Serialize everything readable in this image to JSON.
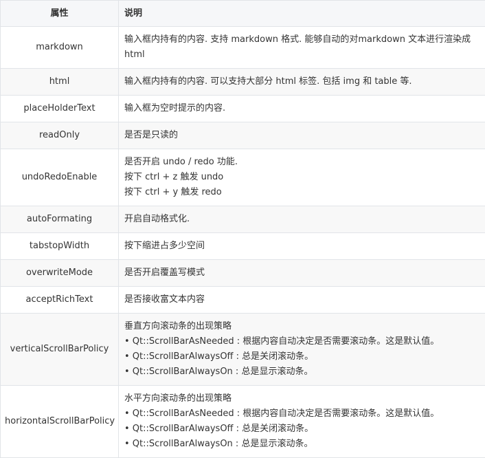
{
  "table": {
    "headers": [
      "属性",
      "说明"
    ],
    "rows": [
      {
        "name": "markdown",
        "lines": [
          "输入框内持有的内容. 支持 markdown 格式. 能够自动的对markdown 文本进行渲染成",
          "html"
        ]
      },
      {
        "name": "html",
        "lines": [
          "输入框内持有的内容. 可以支持大部分 html 标签. 包括 img 和 table 等."
        ]
      },
      {
        "name": "placeHolderText",
        "lines": [
          "输入框为空时提示的内容."
        ]
      },
      {
        "name": "readOnly",
        "lines": [
          "是否是只读的"
        ]
      },
      {
        "name": "undoRedoEnable",
        "lines": [
          "是否开启 undo / redo 功能.",
          "按下 ctrl + z 触发 undo",
          "按下 ctrl + y 触发 redo"
        ]
      },
      {
        "name": "autoFormating",
        "lines": [
          "开启自动格式化."
        ]
      },
      {
        "name": "tabstopWidth",
        "lines": [
          "按下缩进占多少空间"
        ]
      },
      {
        "name": "overwriteMode",
        "lines": [
          "是否开启覆盖写模式"
        ]
      },
      {
        "name": "acceptRichText",
        "lines": [
          "是否接收富文本内容"
        ]
      },
      {
        "name": "verticalScrollBarPolicy",
        "lines": [
          "垂直方向滚动条的出现策略",
          "• Qt::ScrollBarAsNeeded : 根据内容自动决定是否需要滚动条。这是默认值。",
          "• Qt::ScrollBarAlwaysOff : 总是关闭滚动条。",
          "• Qt::ScrollBarAlwaysOn : 总是显示滚动条。"
        ]
      },
      {
        "name": "horizontalScrollBarPolicy",
        "lines": [
          "水平方向滚动条的出现策略",
          "• Qt::ScrollBarAsNeeded : 根据内容自动决定是否需要滚动条。这是默认值。",
          "• Qt::ScrollBarAlwaysOff : 总是关闭滚动条。",
          "• Qt::ScrollBarAlwaysOn : 总是显示滚动条。"
        ]
      }
    ]
  }
}
